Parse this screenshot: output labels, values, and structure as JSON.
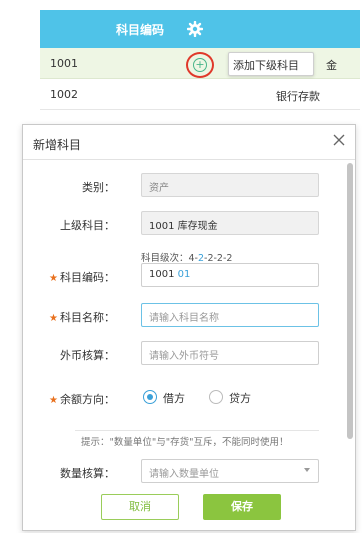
{
  "table": {
    "header_title": "科目编码",
    "rows": [
      {
        "code": "1001",
        "name": "金"
      },
      {
        "code": "1002",
        "name": "银行存款"
      }
    ],
    "tooltip": "添加下级科目"
  },
  "dialog": {
    "title": "新增科目",
    "fields": {
      "category": {
        "label": "类别：",
        "value": "资产"
      },
      "parent": {
        "label": "上级科目：",
        "value": "1001 库存现金"
      },
      "level_hint": {
        "prefix": "科目级次：4-",
        "highlight": "2",
        "suffix": "-2-2-2"
      },
      "code": {
        "label": "科目编码：",
        "value_prefix": "1001",
        "value_suffix": "01"
      },
      "name": {
        "label": "科目名称：",
        "placeholder": "请输入科目名称"
      },
      "currency": {
        "label": "外币核算：",
        "placeholder": "请输入外币符号"
      },
      "balance_direction": {
        "label": "余额方向：",
        "options": [
          "借方",
          "贷方"
        ],
        "selected": "借方"
      },
      "hint": "提示：\"数量单位\"与\"存货\"互斥，不能同时使用！",
      "quantity": {
        "label": "数量核算：",
        "placeholder": "请输入数量单位"
      }
    },
    "buttons": {
      "cancel": "取消",
      "save": "保存"
    }
  },
  "colors": {
    "header_bg": "#4fc3e8",
    "selected_row_bg": "#eef6e4",
    "accent_green": "#8bc53f",
    "accent_blue": "#3aa0d8",
    "required_star": "#e8711f",
    "highlight_circle": "#e0392b"
  },
  "icons": {
    "settings": "gear-icon",
    "add_child": "plus-circle-icon",
    "close": "close-icon",
    "dropdown": "chevron-down-icon",
    "required": "asterisk-icon"
  }
}
